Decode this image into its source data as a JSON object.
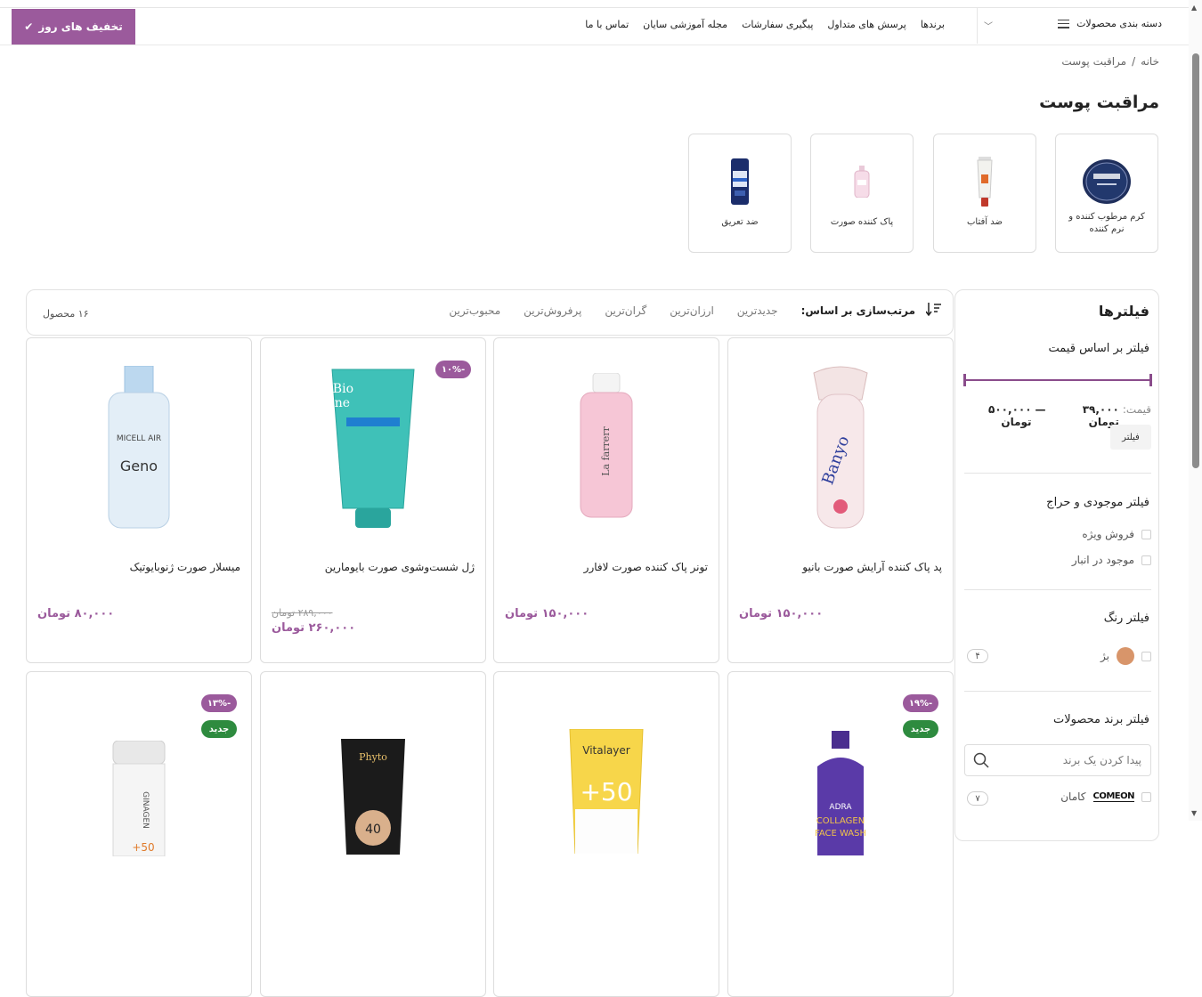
{
  "header": {
    "deal_label": "تخفیف های روز",
    "categories_label": "دسته بندی محصولات",
    "nav": [
      "برندها",
      "پرسش های متداول",
      "پیگیری سفارشات",
      "مجله آموزشی سایان",
      "تماس با ما"
    ]
  },
  "breadcrumb": {
    "home": "خانه",
    "sep": "/",
    "current": "مراقبت پوست"
  },
  "page_title": "مراقبت پوست",
  "subcategories": [
    {
      "label": "کرم مرطوب کننده و نرم کننده",
      "icon": "moisturizer-jar"
    },
    {
      "label": "ضد آفتاب",
      "icon": "sunscreen-tube"
    },
    {
      "label": "پاک کننده صورت",
      "icon": "cleanser-bottle"
    },
    {
      "label": "ضد تعریق",
      "icon": "deodorant-stick"
    }
  ],
  "filters": {
    "title": "فیلترها",
    "price": {
      "heading": "فیلتر بر اساس قیمت",
      "label": "قیمت:",
      "min": "۳۹,۰۰۰ تومان",
      "dash": "—",
      "max": "۵۰۰,۰۰۰ تومان",
      "button": "فیلتر"
    },
    "stock": {
      "heading": "فیلتر موجودی و حراج",
      "options": [
        "فروش ویژه",
        "موجود در انبار"
      ]
    },
    "color": {
      "heading": "فیلتر رنگ",
      "options": [
        {
          "label": "بژ",
          "count": "۴",
          "swatch": "#d8956a"
        }
      ]
    },
    "brand": {
      "heading": "فیلتر برند محصولات",
      "search_placeholder": "پیدا کردن یک برند",
      "options": [
        {
          "logo": "COMEON",
          "label": "کامان",
          "count": "۷"
        }
      ]
    }
  },
  "sort": {
    "lead": "مرتب‌سازی بر اساس:",
    "options": [
      "جدیدترین",
      "ارزان‌ترین",
      "گران‌ترین",
      "پرفروش‌ترین",
      "محبوب‌ترین"
    ],
    "count_label": "۱۶ محصول"
  },
  "products": [
    {
      "name": "پد پاک کننده آرایش صورت بانیو",
      "price": "۱۵۰,۰۰۰ تومان"
    },
    {
      "name": "تونر پاک کننده صورت لافارر",
      "price": "۱۵۰,۰۰۰ تومان"
    },
    {
      "name": "ژل شست‌وشوی صورت بایومارین",
      "old_price": "۲۸۹,۰۰۰ تومان",
      "price": "۲۶۰,۰۰۰ تومان",
      "badge": "-۱۰%"
    },
    {
      "name": "میسلار صورت ژنوبایوتیک",
      "price": "۸۰,۰۰۰ تومان"
    },
    {
      "badge_sale": "-۱۹%",
      "badge_new": "جدید"
    },
    {},
    {},
    {
      "badge_sale": "-۱۳%",
      "badge_new": "جدید"
    }
  ],
  "colors": {
    "accent": "#9b5a9c",
    "new_badge": "#2e8b3f"
  }
}
